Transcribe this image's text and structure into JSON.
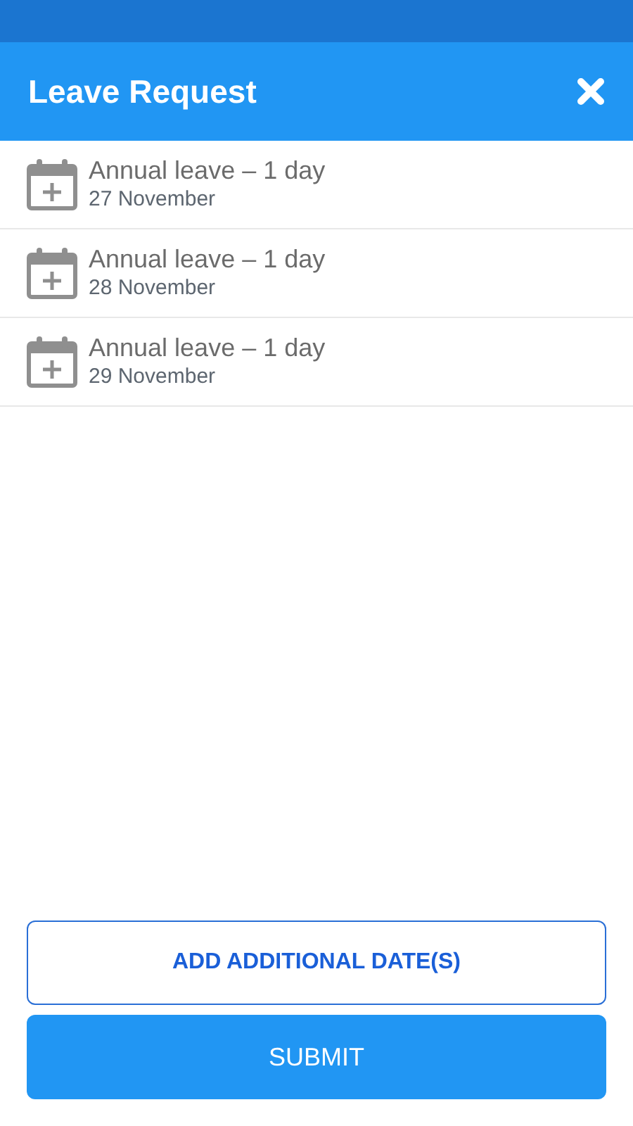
{
  "header": {
    "title": "Leave Request"
  },
  "items": [
    {
      "title": "Annual leave – 1 day",
      "date": "27 November"
    },
    {
      "title": "Annual leave – 1 day",
      "date": "28 November"
    },
    {
      "title": "Annual leave – 1 day",
      "date": "29 November"
    }
  ],
  "buttons": [
    {
      "label": "ADD ADDITIONAL DATE(S)",
      "kind": "outline"
    },
    {
      "label": "SUBMIT",
      "kind": "primary"
    }
  ]
}
